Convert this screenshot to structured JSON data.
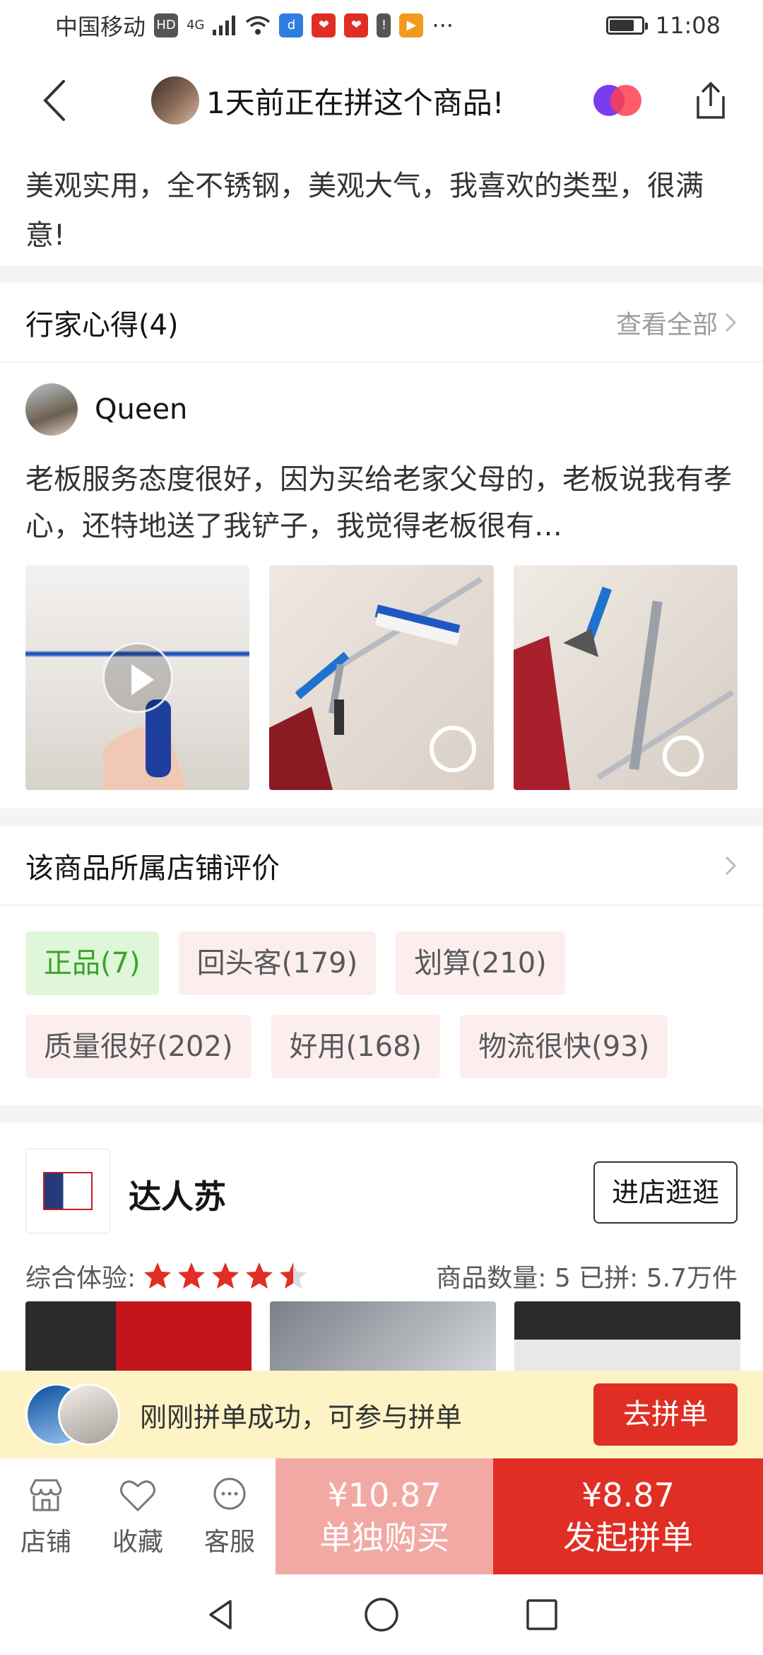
{
  "status_bar": {
    "carrier": "中国移动",
    "hd": "HD",
    "network": "4G",
    "time": "11:08",
    "more": "···",
    "battery_level": 0.75
  },
  "nav": {
    "title": "1天前正在拼这个商品!",
    "back_icon": "chevron-left-icon",
    "share_icon": "share-icon"
  },
  "review": {
    "text": "美观实用，全不锈钢，美观大气，我喜欢的类型，很满意!"
  },
  "expert_section": {
    "title": "行家心得(4)",
    "view_all": "查看全部",
    "user": "Queen",
    "text": "老板服务态度很好，因为买给老家父母的，老板说我有孝心，还特地送了我铲子，我觉得老板很有…"
  },
  "store_eval": {
    "title": "该商品所属店铺评价",
    "tags": [
      {
        "label": "正品(7)",
        "style": "green"
      },
      {
        "label": "回头客(179)",
        "style": "pink"
      },
      {
        "label": "划算(210)",
        "style": "pink"
      },
      {
        "label": "质量很好(202)",
        "style": "pink"
      },
      {
        "label": "好用(168)",
        "style": "pink"
      },
      {
        "label": "物流很快(93)",
        "style": "pink"
      }
    ]
  },
  "shop": {
    "name": "达人苏",
    "enter_label": "进店逛逛",
    "experience_label": "综合体验:",
    "rating": 4.5,
    "stats": "商品数量: 5   已拼: 5.7万件"
  },
  "banner": {
    "text": "刚刚拼单成功，可参与拼单",
    "button": "去拼单"
  },
  "bottom_bar": {
    "store": "店铺",
    "favorite": "收藏",
    "service": "客服",
    "single_price": "¥10.87",
    "single_label": "单独购买",
    "group_price": "¥8.87",
    "group_label": "发起拼单"
  },
  "colors": {
    "accent": "#e02e24",
    "single_buy": "#f2a9a4",
    "tag_green_bg": "#dff7d8",
    "tag_pink_bg": "#fdeeee",
    "banner_bg": "#fdf3c5"
  }
}
